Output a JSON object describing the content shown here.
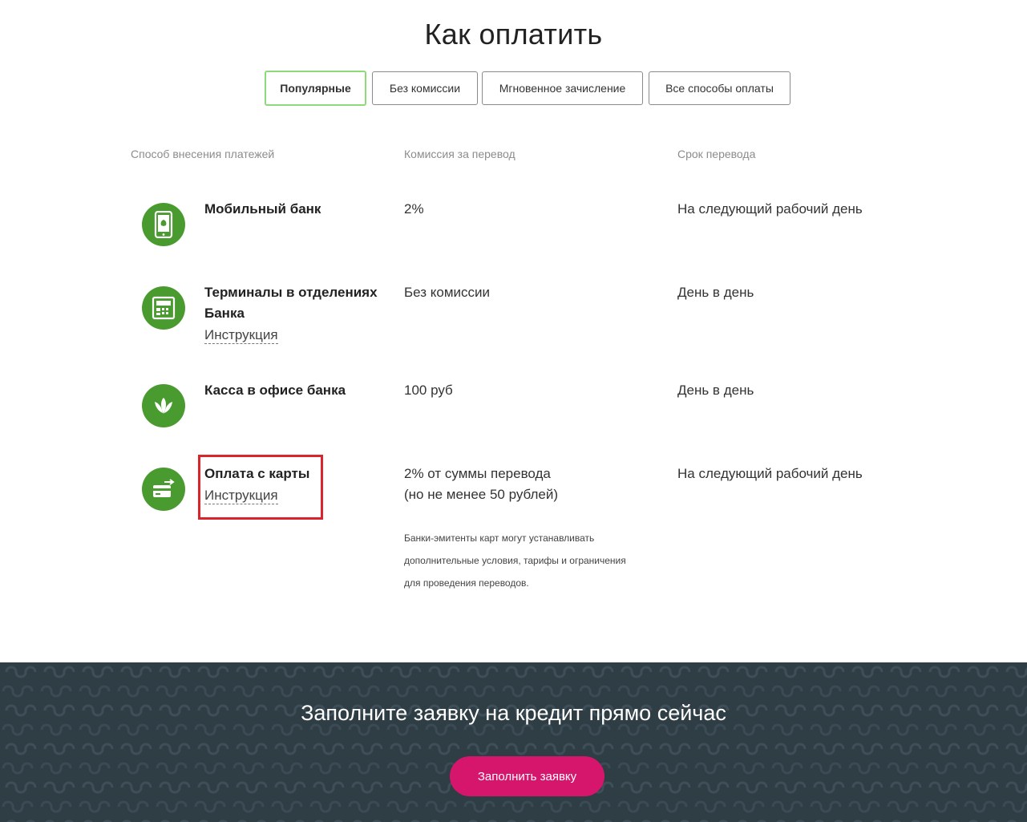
{
  "page": {
    "title": "Как оплатить"
  },
  "tabs": [
    {
      "label": "Популярные",
      "active": true
    },
    {
      "label": "Без комиссии",
      "active": false
    },
    {
      "label": "Мгновенное зачисление",
      "active": false
    },
    {
      "label": "Все способы оплаты",
      "active": false
    }
  ],
  "table": {
    "headers": {
      "method": "Способ внесения платежей",
      "fee": "Комиссия за перевод",
      "time": "Срок перевода"
    },
    "rows": [
      {
        "icon": "mobile-phone-icon",
        "name": "Мобильный банк",
        "link": "",
        "fee": "2%",
        "fee_line2": "",
        "time": "На следующий рабочий день"
      },
      {
        "icon": "terminal-icon",
        "name": "Терминалы в отделениях Банка",
        "link": "Инструкция",
        "fee": "Без комиссии",
        "fee_line2": "",
        "time": "День в день"
      },
      {
        "icon": "bank-leaf-icon",
        "name": "Касса в офисе банка",
        "link": "",
        "fee": "100 руб",
        "fee_line2": "",
        "time": "День в день"
      },
      {
        "icon": "card-transfer-icon",
        "name": "Оплата с карты",
        "link": "Инструкция",
        "fee": "2% от суммы перевода",
        "fee_line2": "(но не менее 50 рублей)",
        "time": "На следующий рабочий день"
      }
    ],
    "note": {
      "line1": "Банки-эмитенты карт могут устанавливать",
      "line2": "дополнительные условия, тарифы и ограничения",
      "line3": "для проведения переводов."
    }
  },
  "cta": {
    "text": "Заполните заявку на кредит прямо сейчас",
    "button_label": "Заполнить заявку"
  },
  "colors": {
    "brand_green": "#4a9b2f",
    "active_tab_border": "#8ed97a",
    "highlight_red": "#d9232d",
    "cta_background": "#2f3d45",
    "cta_button": "#d6166d"
  }
}
